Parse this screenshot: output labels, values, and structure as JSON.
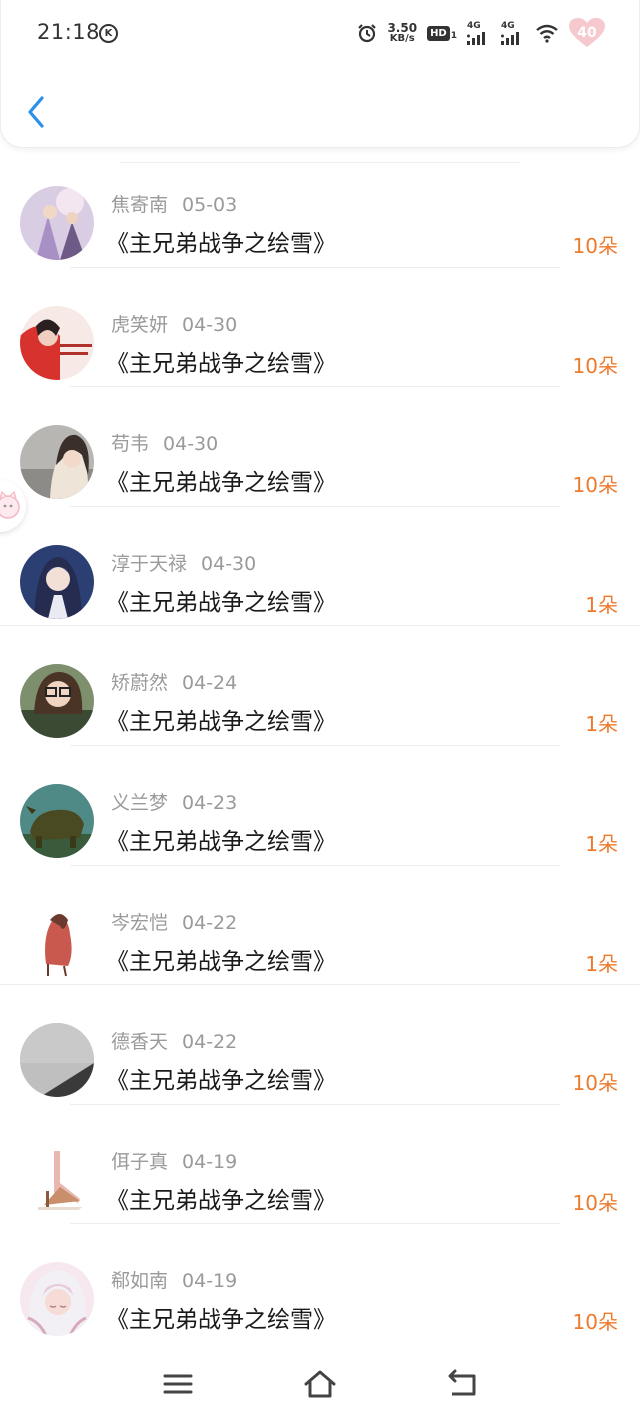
{
  "status_bar": {
    "time": "21:18",
    "k_badge": "K",
    "speed_value": "3.50",
    "speed_unit": "KB/s",
    "hd_label": "HD",
    "hd_sub": "1",
    "network_1": "4G",
    "network_2": "4G",
    "battery": "40",
    "icons": [
      "k-circle-icon",
      "alarm-icon",
      "hd-icon",
      "signal-icon",
      "signal-icon",
      "wifi-icon",
      "battery-heart-icon"
    ]
  },
  "header": {
    "back_icon": "chevron-left-icon"
  },
  "rows": [
    {
      "name": "焦寄南",
      "date": "05-03",
      "title": "《主兄弟战争之绘雪》",
      "amount": "10朵"
    },
    {
      "name": "虎笑妍",
      "date": "04-30",
      "title": "《主兄弟战争之绘雪》",
      "amount": "10朵"
    },
    {
      "name": "苟韦",
      "date": "04-30",
      "title": "《主兄弟战争之绘雪》",
      "amount": "10朵"
    },
    {
      "name": "淳于天禄",
      "date": "04-30",
      "title": "《主兄弟战争之绘雪》",
      "amount": "1朵"
    },
    {
      "name": "矫蔚然",
      "date": "04-24",
      "title": "《主兄弟战争之绘雪》",
      "amount": "1朵"
    },
    {
      "name": "义兰梦",
      "date": "04-23",
      "title": "《主兄弟战争之绘雪》",
      "amount": "1朵"
    },
    {
      "name": "岑宏恺",
      "date": "04-22",
      "title": "《主兄弟战争之绘雪》",
      "amount": "1朵"
    },
    {
      "name": "德香天",
      "date": "04-22",
      "title": "《主兄弟战争之绘雪》",
      "amount": "10朵"
    },
    {
      "name": "佴子真",
      "date": "04-19",
      "title": "《主兄弟战争之绘雪》",
      "amount": "10朵"
    },
    {
      "name": "郗如南",
      "date": "04-19",
      "title": "《主兄弟战争之绘雪》",
      "amount": "10朵"
    }
  ],
  "colors": {
    "accent_back": "#2b8ff0",
    "amount": "#ee7a2c",
    "meta": "#9a9a9a"
  },
  "nav": {
    "icons": [
      "menu-icon",
      "home-icon",
      "back-nav-icon"
    ]
  }
}
